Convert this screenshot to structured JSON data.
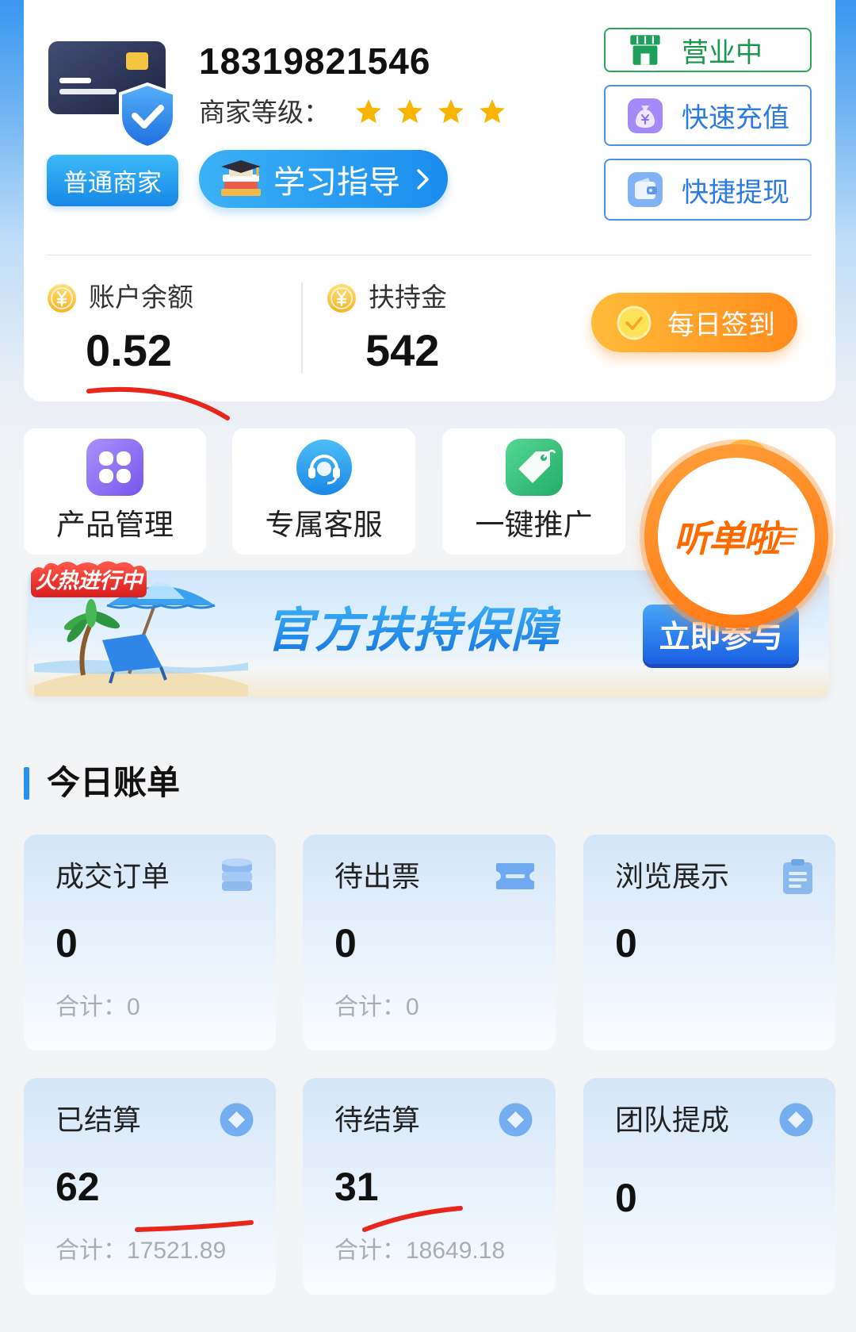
{
  "merchant": {
    "card_icon": "merchant-card-shield-icon",
    "phone": "18319821546",
    "level_label": "商家等级：",
    "level_stars": 4,
    "star_icon": "star-icon",
    "type_badge": "普通商家",
    "guide_button": {
      "label": "学习指导",
      "icon": "study-books-icon",
      "trailing_icon": "chevron-right-icon"
    },
    "status_button": {
      "label": "营业中",
      "icon": "store-icon"
    },
    "recharge_button": {
      "label": "快速充值",
      "icon": "money-bag-icon"
    },
    "withdraw_button": {
      "label": "快捷提现",
      "icon": "wallet-icon"
    }
  },
  "balance": {
    "account": {
      "label": "账户余额",
      "value": "0.52",
      "icon": "coin-icon"
    },
    "support": {
      "label": "扶持金",
      "value": "542",
      "icon": "coin-icon"
    },
    "checkin_button": {
      "label": "每日签到",
      "icon": "check-circle-icon"
    }
  },
  "shortcuts": [
    {
      "label": "产品管理",
      "icon": "product-grid-icon"
    },
    {
      "label": "专属客服",
      "icon": "headset-icon"
    },
    {
      "label": "一键推广",
      "icon": "promotion-tag-icon"
    },
    {
      "icon": "orange-badge-icon"
    }
  ],
  "floating_button": {
    "label": "听单啦"
  },
  "banner": {
    "badge": "火热进行中",
    "title": "官方扶持保障",
    "button": "立即参与",
    "illustration": "beach-umbrella-chair-palm-icon"
  },
  "bills": {
    "title": "今日账单",
    "cards": [
      {
        "title": "成交订单",
        "value": "0",
        "total_label": "合计：",
        "total": "0",
        "icon": "database-stack-icon"
      },
      {
        "title": "待出票",
        "value": "0",
        "total_label": "合计：",
        "total": "0",
        "icon": "ticket-icon"
      },
      {
        "title": "浏览展示",
        "value": "0",
        "icon": "clipboard-icon"
      },
      {
        "title": "已结算",
        "value": "62",
        "total_label": "合计：",
        "total": "17521.89",
        "icon": "diamond-circle-icon"
      },
      {
        "title": "待结算",
        "value": "31",
        "total_label": "合计：",
        "total": "18649.18",
        "icon": "diamond-circle-icon"
      },
      {
        "title": "团队提成",
        "value": "0",
        "icon": "diamond-circle-icon"
      }
    ]
  },
  "colors": {
    "primary_blue": "#1b8cef",
    "status_green": "#17984a",
    "checkin_orange": "#ff8b1c",
    "star_yellow": "#f7b500",
    "annotation_red": "#e8261b",
    "page_background": "#f3f4f6"
  }
}
